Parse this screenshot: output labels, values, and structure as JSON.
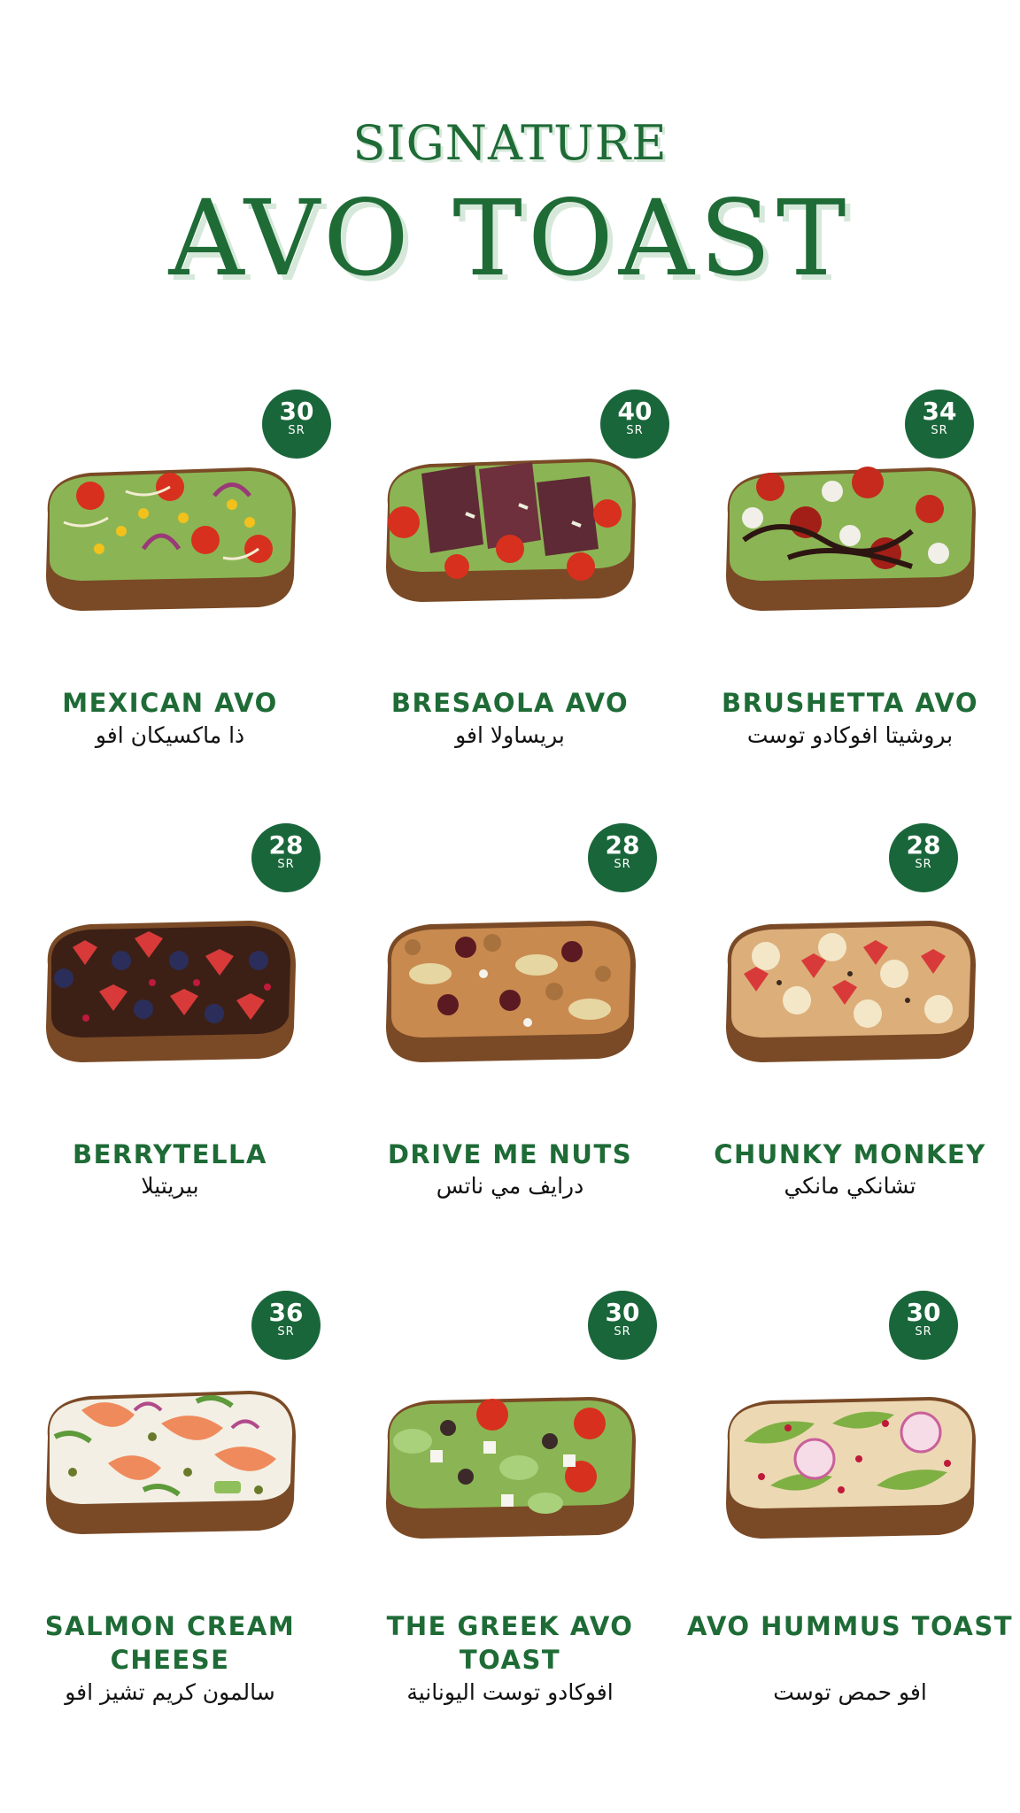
{
  "header": {
    "subtitle": "SIGNATURE",
    "title": "AVO TOAST"
  },
  "colors": {
    "brand_green": "#1e6b36",
    "badge_green": "#19663a"
  },
  "items": [
    {
      "name_en": "MEXICAN AVO",
      "name_ar": "ذا ماكسيكان افو",
      "price": "30",
      "currency": "SR",
      "topping": "mexican"
    },
    {
      "name_en": "BRESAOLA AVO",
      "name_ar": "بريساولا افو",
      "price": "40",
      "currency": "SR",
      "topping": "bresaola"
    },
    {
      "name_en": "BRUSHETTA AVO",
      "name_ar": "بروشيتا افوكادو توست",
      "price": "34",
      "currency": "SR",
      "topping": "brushetta"
    },
    {
      "name_en": "BERRYTELLA",
      "name_ar": "بيريتيلا",
      "price": "28",
      "currency": "SR",
      "topping": "berry"
    },
    {
      "name_en": "DRIVE ME NUTS",
      "name_ar": "درايف مي ناتس",
      "price": "28",
      "currency": "SR",
      "topping": "nuts"
    },
    {
      "name_en": "CHUNKY MONKEY",
      "name_ar": "تشانكي مانكي",
      "price": "28",
      "currency": "SR",
      "topping": "monkey"
    },
    {
      "name_en": "SALMON CREAM CHEESE",
      "name_ar": "سالمون كريم تشيز افو",
      "price": "36",
      "currency": "SR",
      "topping": "salmon"
    },
    {
      "name_en": "THE GREEK AVO TOAST",
      "name_ar": "افوكادو توست اليونانية",
      "price": "30",
      "currency": "SR",
      "topping": "greek"
    },
    {
      "name_en": "AVO HUMMUS TOAST",
      "name_ar": "افو حمص توست",
      "price": "30",
      "currency": "SR",
      "topping": "hummus"
    }
  ]
}
